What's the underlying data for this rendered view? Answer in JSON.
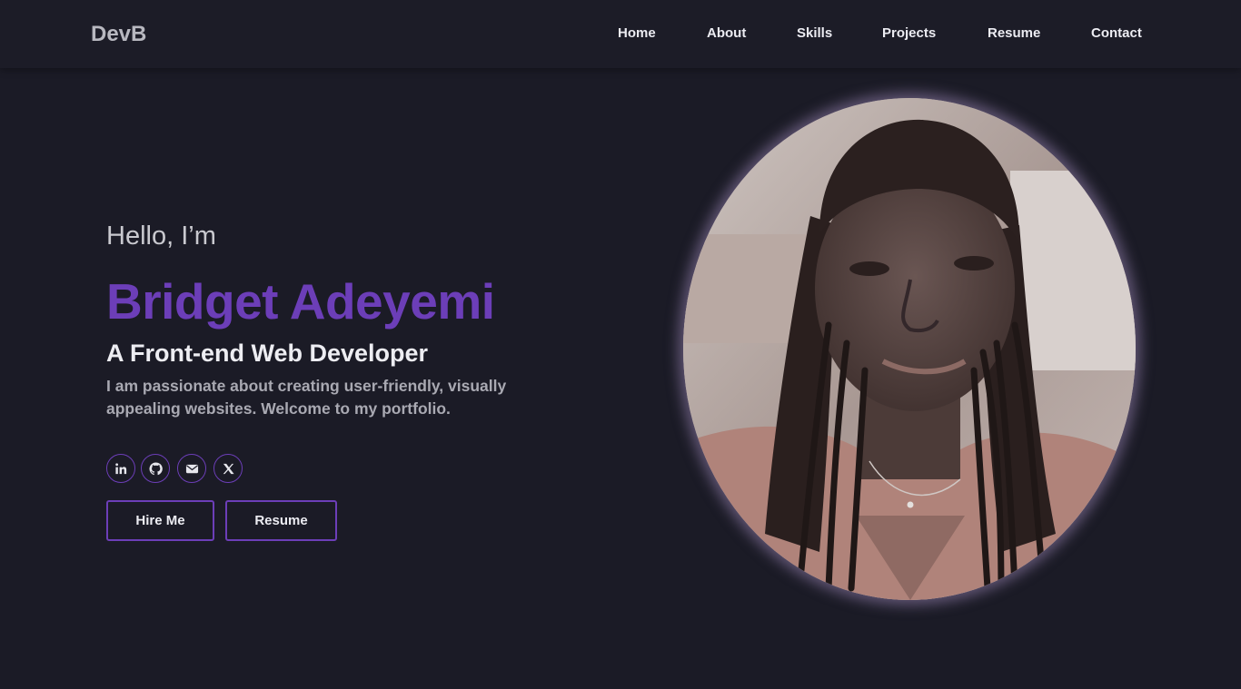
{
  "brand": {
    "logo": "DevB"
  },
  "nav": {
    "items": [
      {
        "label": "Home"
      },
      {
        "label": "About"
      },
      {
        "label": "Skills"
      },
      {
        "label": "Projects"
      },
      {
        "label": "Resume"
      },
      {
        "label": "Contact"
      }
    ]
  },
  "hero": {
    "greeting": "Hello, I’m",
    "name": "Bridget Adeyemi",
    "role": "A Front-end Web Developer",
    "bio": "I am passionate about creating user-friendly, visually appealing websites. Welcome to my portfolio."
  },
  "socials": {
    "items": [
      {
        "icon": "linkedin-icon"
      },
      {
        "icon": "github-icon"
      },
      {
        "icon": "envelope-icon"
      },
      {
        "icon": "x-twitter-icon"
      }
    ]
  },
  "actions": {
    "hire_label": "Hire Me",
    "resume_label": "Resume"
  },
  "colors": {
    "background": "#1b1b26",
    "accent": "#6c3eb8",
    "text": "#ececf2",
    "muted": "#a9a9b2"
  }
}
